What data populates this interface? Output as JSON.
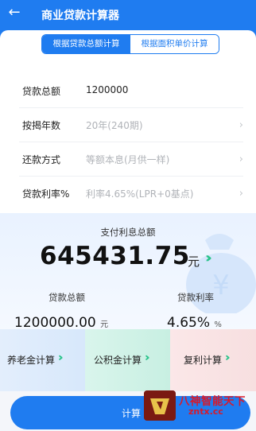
{
  "header": {
    "title": "商业贷款计算器",
    "back_icon": "arrow-left-icon"
  },
  "mode_tabs": [
    {
      "label": "根据贷款总额计算",
      "active": true
    },
    {
      "label": "根据面积单价计算",
      "active": false
    }
  ],
  "form": {
    "rows": [
      {
        "label": "贷款总额",
        "value": "1200000"
      },
      {
        "label": "按揭年数",
        "value": "20年(240期)"
      },
      {
        "label": "还款方式",
        "value": "等额本息(月供一样)"
      },
      {
        "label": "贷款利率%",
        "value": "利率4.65%(LPR+0基点)"
      }
    ]
  },
  "result": {
    "interest_label": "支付利息总额",
    "interest_value": "645431.75",
    "interest_unit": "元",
    "loan_label": "贷款总额",
    "loan_value": "1200000.00",
    "loan_unit": "元",
    "rate_label": "贷款利率",
    "rate_value": "4.65%",
    "rate_unit": "%"
  },
  "tiles": [
    {
      "label": "养老金计算"
    },
    {
      "label": "公积金计算"
    },
    {
      "label": "复利计算"
    }
  ],
  "calculate_button": {
    "label": "计算"
  },
  "watermark": {
    "line1": "八神智能天下",
    "line2": "zntx.cc"
  },
  "colors": {
    "primary": "#1f7cf0",
    "accent_green": "#29c38a",
    "placeholder": "#b0b3b8"
  }
}
